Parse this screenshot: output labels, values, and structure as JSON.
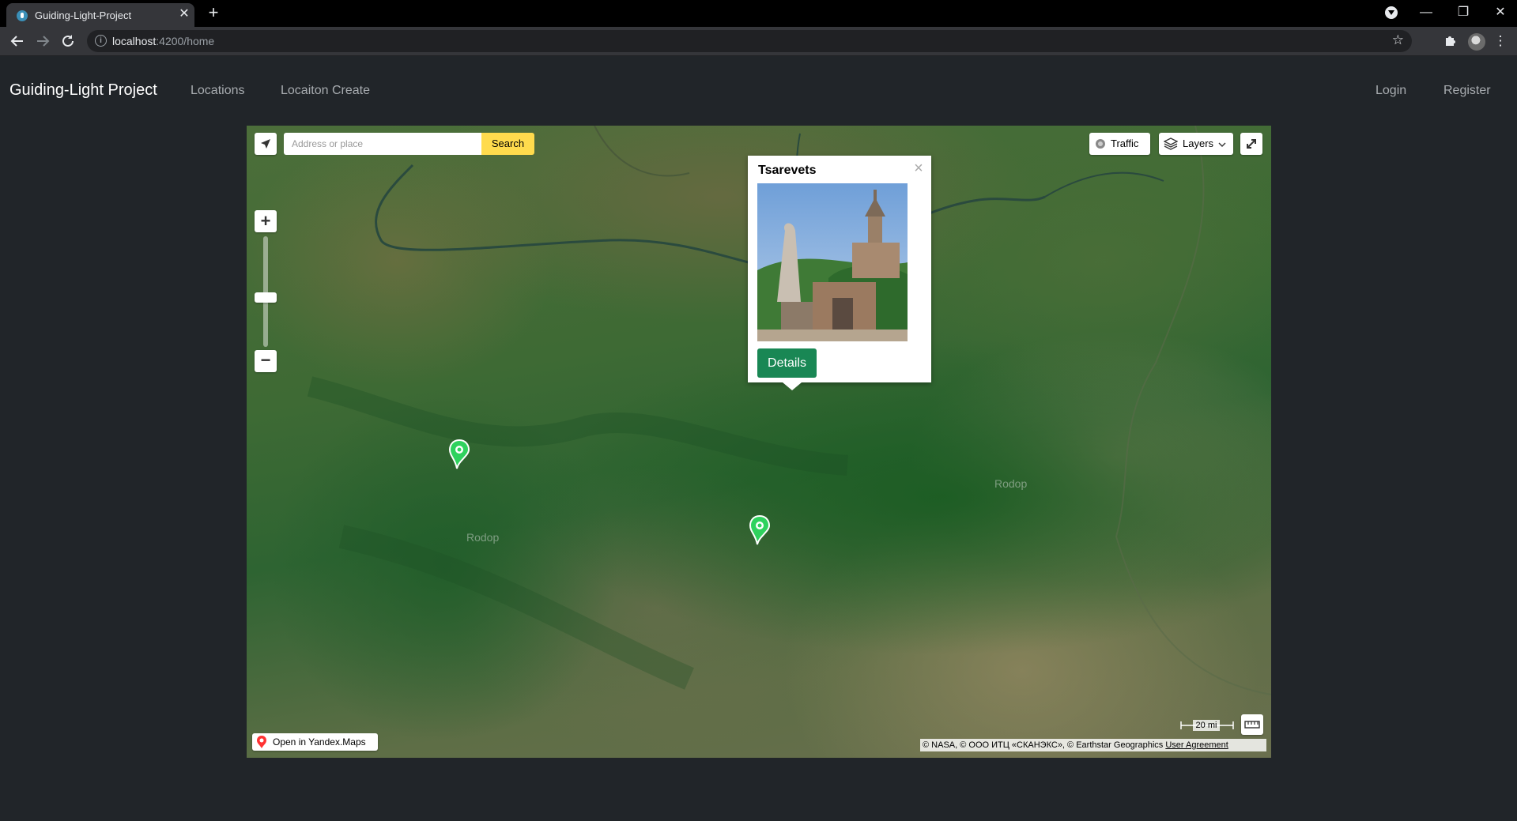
{
  "browser": {
    "tab_title": "Guiding-Light-Project",
    "close_glyph": "✕",
    "new_tab_glyph": "+",
    "url_host": "localhost",
    "url_path": ":4200/home",
    "window_controls": [
      "—",
      "❐",
      "✕"
    ]
  },
  "navbar": {
    "brand": "Guiding-Light Project",
    "links": [
      "Locations",
      "Locaiton Create"
    ],
    "auth": [
      "Login",
      "Register"
    ]
  },
  "map": {
    "search_placeholder": "Address or place",
    "search_button": "Search",
    "traffic_label": "Traffic",
    "layers_label": "Layers",
    "open_in_maps": "Open in Yandex.Maps",
    "scale_label": "20 mi",
    "copyright": "© NASA, © ООО ИТЦ «СКАНЭКС», © Earthstar Geographics",
    "user_agreement": "User Agreement",
    "place_labels": [
      "Rodop",
      "Rodop"
    ],
    "balloon": {
      "title": "Tsarevets",
      "button": "Details"
    },
    "colors": {
      "search_button": "#ffdb4d",
      "marker": "#2fd25e",
      "details_button": "#198754"
    }
  }
}
